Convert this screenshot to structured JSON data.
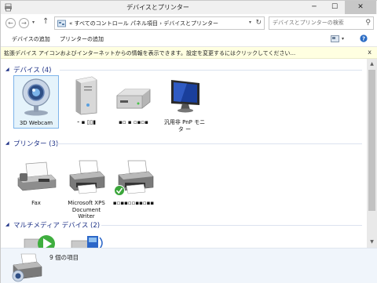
{
  "window": {
    "title": "デバイスとプリンター",
    "minimize": "─",
    "maximize": "☐",
    "close": "✕"
  },
  "address": {
    "path": "« すべてのコントロール パネル項目 › デバイスとプリンター",
    "search_placeholder": "デバイスとプリンターの検索"
  },
  "toolbar": {
    "add_device": "デバイスの追加",
    "add_printer": "プリンターの追加"
  },
  "infobar": {
    "message": "拡張デバイス アイコンおよびインターネットからの情報を表示できます。設定を変更するにはクリックしてください...",
    "close": "x"
  },
  "groups": {
    "devices": {
      "header": "デバイス (4)",
      "items": [
        {
          "label": "3D Webcam",
          "icon": "webcam-icon"
        },
        {
          "label": "⁃ ▪ ▯▯▮",
          "icon": "computer-tower-icon"
        },
        {
          "label": "▪▫ ▪ ▫▪▫▪",
          "icon": "external-drive-icon"
        },
        {
          "label": "汎用非 PnP モニタ ー",
          "icon": "monitor-icon"
        }
      ]
    },
    "printers": {
      "header": "プリンター (3)",
      "items": [
        {
          "label": "Fax",
          "icon": "fax-icon"
        },
        {
          "label": "Microsoft XPS Document Writer",
          "icon": "printer-icon"
        },
        {
          "label": "▪▫▪▪▫▫▪▪▫▪▪",
          "icon": "default-printer-icon"
        }
      ]
    },
    "multimedia": {
      "header": "マルチメディア デバイス (2)"
    }
  },
  "status": {
    "text": "9 個の項目"
  },
  "colors": {
    "group_header": "#1e3287",
    "infobar_bg": "#ffffe1",
    "selection": "#e5f3fb"
  }
}
